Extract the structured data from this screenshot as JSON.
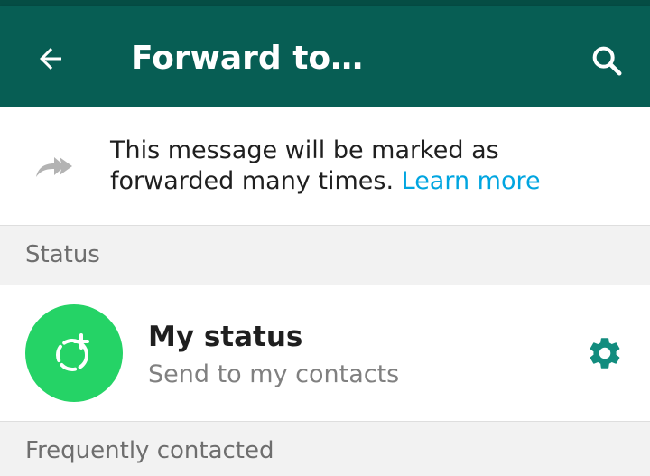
{
  "app_bar": {
    "title": "Forward to…",
    "back_icon": "arrow-left-icon",
    "search_icon": "search-icon"
  },
  "notice": {
    "icon": "double-forward-arrow-icon",
    "text": "This message will be marked as forwarded many times.",
    "link_label": "Learn more"
  },
  "sections": {
    "status_header": "Status",
    "frequent_header": "Frequently contacted"
  },
  "status_row": {
    "title": "My status",
    "subtitle": "Send to my contacts",
    "avatar_icon": "status-add-icon",
    "settings_icon": "gear-icon"
  },
  "colors": {
    "app_bar": "#075e54",
    "status_bar": "#054d44",
    "accent_green": "#25d366",
    "teal_icon": "#128c7e",
    "link_blue": "#00a5e0"
  }
}
